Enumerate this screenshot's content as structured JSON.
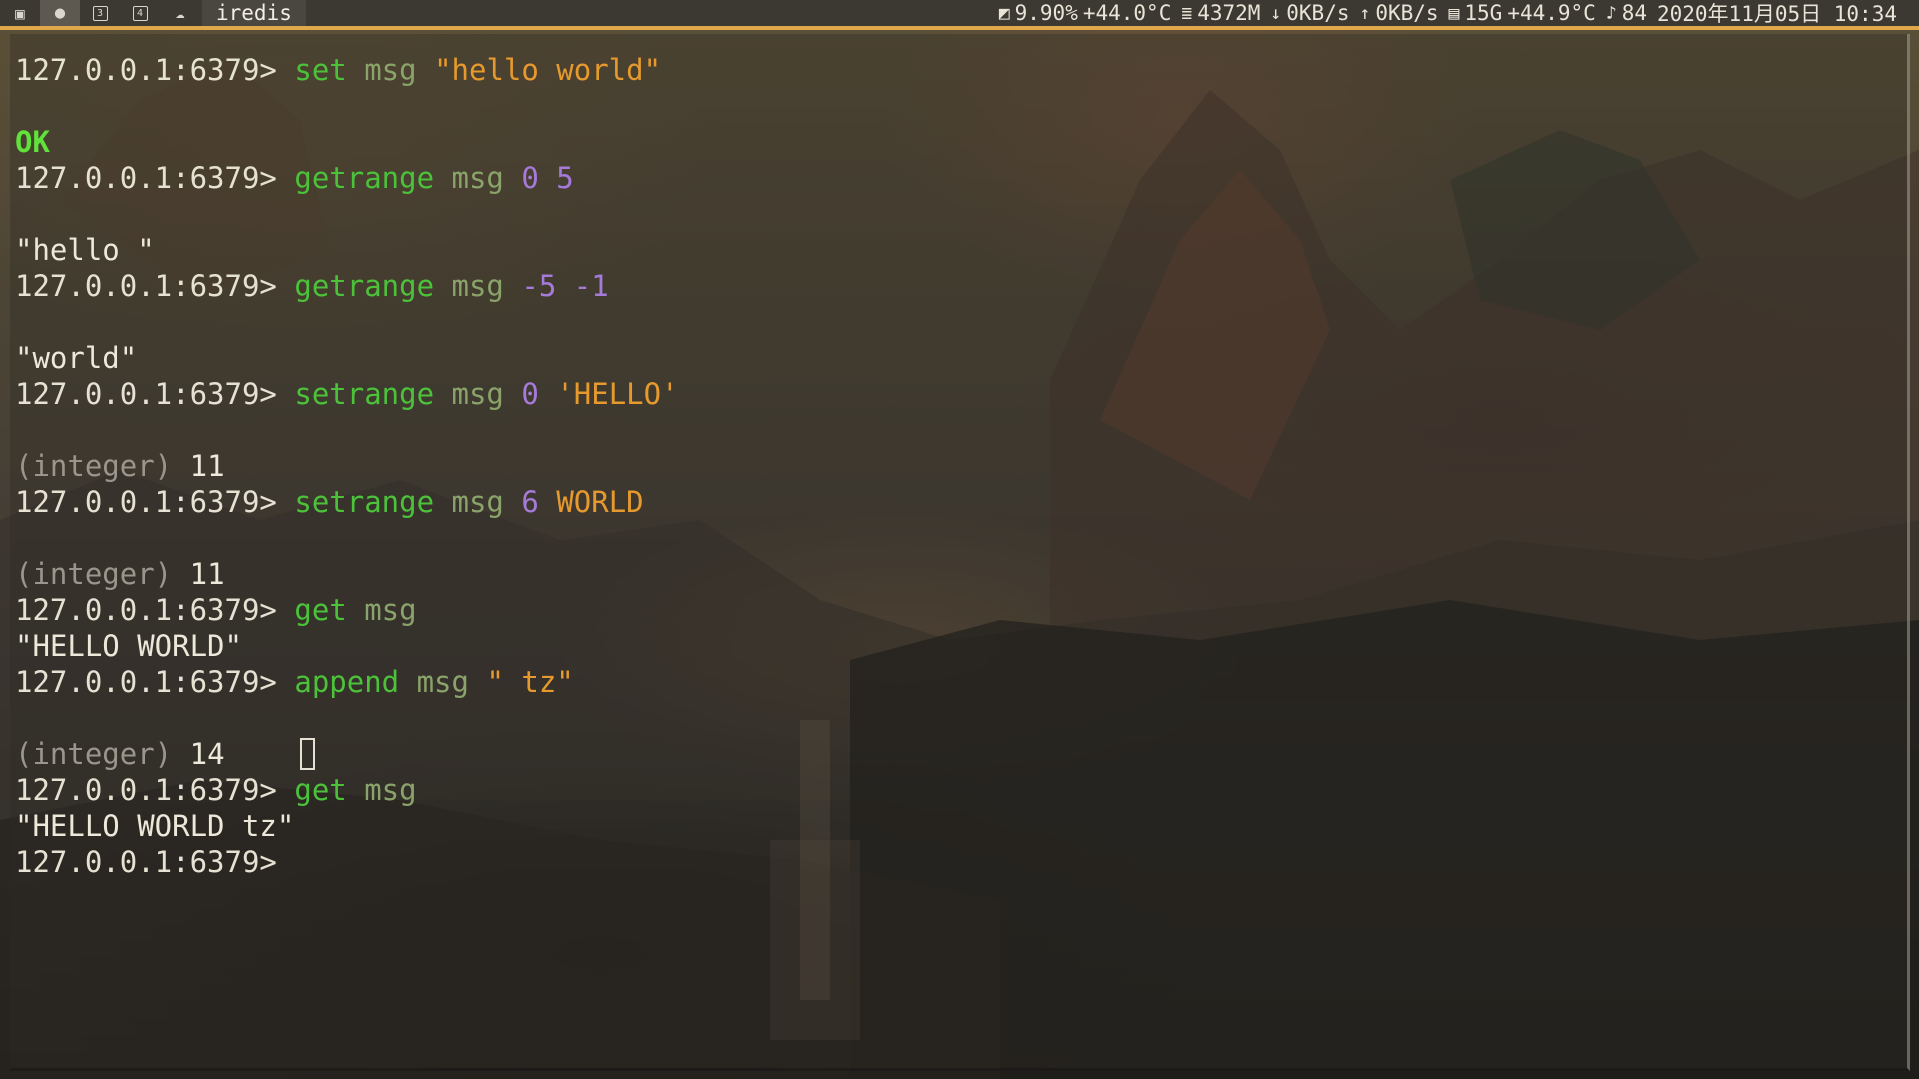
{
  "topbar": {
    "workspaces": [
      {
        "icon": "terminal-icon",
        "glyph": "▣",
        "active": false
      },
      {
        "icon": "apple-icon",
        "glyph": "",
        "active": true
      },
      {
        "icon": "workspace-3-icon",
        "glyph": "3",
        "active": false
      },
      {
        "icon": "workspace-4-icon",
        "glyph": "4",
        "active": false
      },
      {
        "icon": "cloud-icon",
        "glyph": "☁",
        "active": false
      }
    ],
    "window_title": "iredis",
    "status": {
      "cpu": "9.90%",
      "cpu_temp": "+44.0°C",
      "memory": "4372M",
      "download": "0KB/s",
      "upload": "0KB/s",
      "disk": "15G",
      "disk_temp": "+44.9°C",
      "notifications": "84",
      "datetime": "2020年11月05日 10:34"
    }
  },
  "terminal": {
    "lines": [
      {
        "segs": [
          {
            "t": "127.0.0.1:6379> ",
            "c": "prompt"
          },
          {
            "t": "set",
            "c": "cmd"
          },
          {
            "t": " ",
            "c": "plain"
          },
          {
            "t": "msg",
            "c": "key"
          },
          {
            "t": " ",
            "c": "plain"
          },
          {
            "t": "\"hello world\"",
            "c": "str"
          }
        ]
      },
      {
        "segs": []
      },
      {
        "segs": [
          {
            "t": "OK",
            "c": "ok"
          }
        ]
      },
      {
        "segs": [
          {
            "t": "127.0.0.1:6379> ",
            "c": "prompt"
          },
          {
            "t": "getrange",
            "c": "cmd"
          },
          {
            "t": " ",
            "c": "plain"
          },
          {
            "t": "msg",
            "c": "key"
          },
          {
            "t": " ",
            "c": "plain"
          },
          {
            "t": "0 5",
            "c": "num"
          }
        ]
      },
      {
        "segs": []
      },
      {
        "segs": [
          {
            "t": "\"hello \"",
            "c": "plain"
          }
        ]
      },
      {
        "segs": [
          {
            "t": "127.0.0.1:6379> ",
            "c": "prompt"
          },
          {
            "t": "getrange",
            "c": "cmd"
          },
          {
            "t": " ",
            "c": "plain"
          },
          {
            "t": "msg",
            "c": "key"
          },
          {
            "t": " ",
            "c": "plain"
          },
          {
            "t": "-5 -1",
            "c": "num"
          }
        ]
      },
      {
        "segs": []
      },
      {
        "segs": [
          {
            "t": "\"world\"",
            "c": "plain"
          }
        ]
      },
      {
        "segs": [
          {
            "t": "127.0.0.1:6379> ",
            "c": "prompt"
          },
          {
            "t": "setrange",
            "c": "cmd"
          },
          {
            "t": " ",
            "c": "plain"
          },
          {
            "t": "msg",
            "c": "key"
          },
          {
            "t": " ",
            "c": "plain"
          },
          {
            "t": "0",
            "c": "num"
          },
          {
            "t": " ",
            "c": "plain"
          },
          {
            "t": "'HELLO'",
            "c": "str"
          }
        ]
      },
      {
        "segs": []
      },
      {
        "segs": [
          {
            "t": "(integer) ",
            "c": "muted"
          },
          {
            "t": "11",
            "c": "plain"
          }
        ]
      },
      {
        "segs": [
          {
            "t": "127.0.0.1:6379> ",
            "c": "prompt"
          },
          {
            "t": "setrange",
            "c": "cmd"
          },
          {
            "t": " ",
            "c": "plain"
          },
          {
            "t": "msg",
            "c": "key"
          },
          {
            "t": " ",
            "c": "plain"
          },
          {
            "t": "6",
            "c": "num"
          },
          {
            "t": " ",
            "c": "plain"
          },
          {
            "t": "WORLD",
            "c": "str"
          }
        ]
      },
      {
        "segs": []
      },
      {
        "segs": [
          {
            "t": "(integer) ",
            "c": "muted"
          },
          {
            "t": "11",
            "c": "plain"
          }
        ]
      },
      {
        "segs": [
          {
            "t": "127.0.0.1:6379> ",
            "c": "prompt"
          },
          {
            "t": "get",
            "c": "cmd"
          },
          {
            "t": " ",
            "c": "plain"
          },
          {
            "t": "msg",
            "c": "key"
          }
        ]
      },
      {
        "segs": [
          {
            "t": "\"HELLO WORLD\"",
            "c": "plain"
          }
        ]
      },
      {
        "segs": [
          {
            "t": "127.0.0.1:6379> ",
            "c": "prompt"
          },
          {
            "t": "append",
            "c": "cmd"
          },
          {
            "t": " ",
            "c": "plain"
          },
          {
            "t": "msg",
            "c": "key"
          },
          {
            "t": " ",
            "c": "plain"
          },
          {
            "t": "\" tz\"",
            "c": "str"
          }
        ]
      },
      {
        "segs": []
      },
      {
        "segs": [
          {
            "t": "(integer) ",
            "c": "muted"
          },
          {
            "t": "14",
            "c": "plain"
          }
        ],
        "cursor": true
      },
      {
        "segs": [
          {
            "t": "127.0.0.1:6379> ",
            "c": "prompt"
          },
          {
            "t": "get",
            "c": "cmd"
          },
          {
            "t": " ",
            "c": "plain"
          },
          {
            "t": "msg",
            "c": "key"
          }
        ]
      },
      {
        "segs": [
          {
            "t": "\"HELLO WORLD tz\"",
            "c": "plain"
          }
        ]
      },
      {
        "segs": [
          {
            "t": "127.0.0.1:6379> ",
            "c": "prompt"
          }
        ]
      }
    ]
  },
  "colors": {
    "accent_border": "#e0a84a",
    "command": "#4cc23a",
    "string": "#e69a2e",
    "number": "#a57ad9",
    "ok": "#5fe23a"
  }
}
